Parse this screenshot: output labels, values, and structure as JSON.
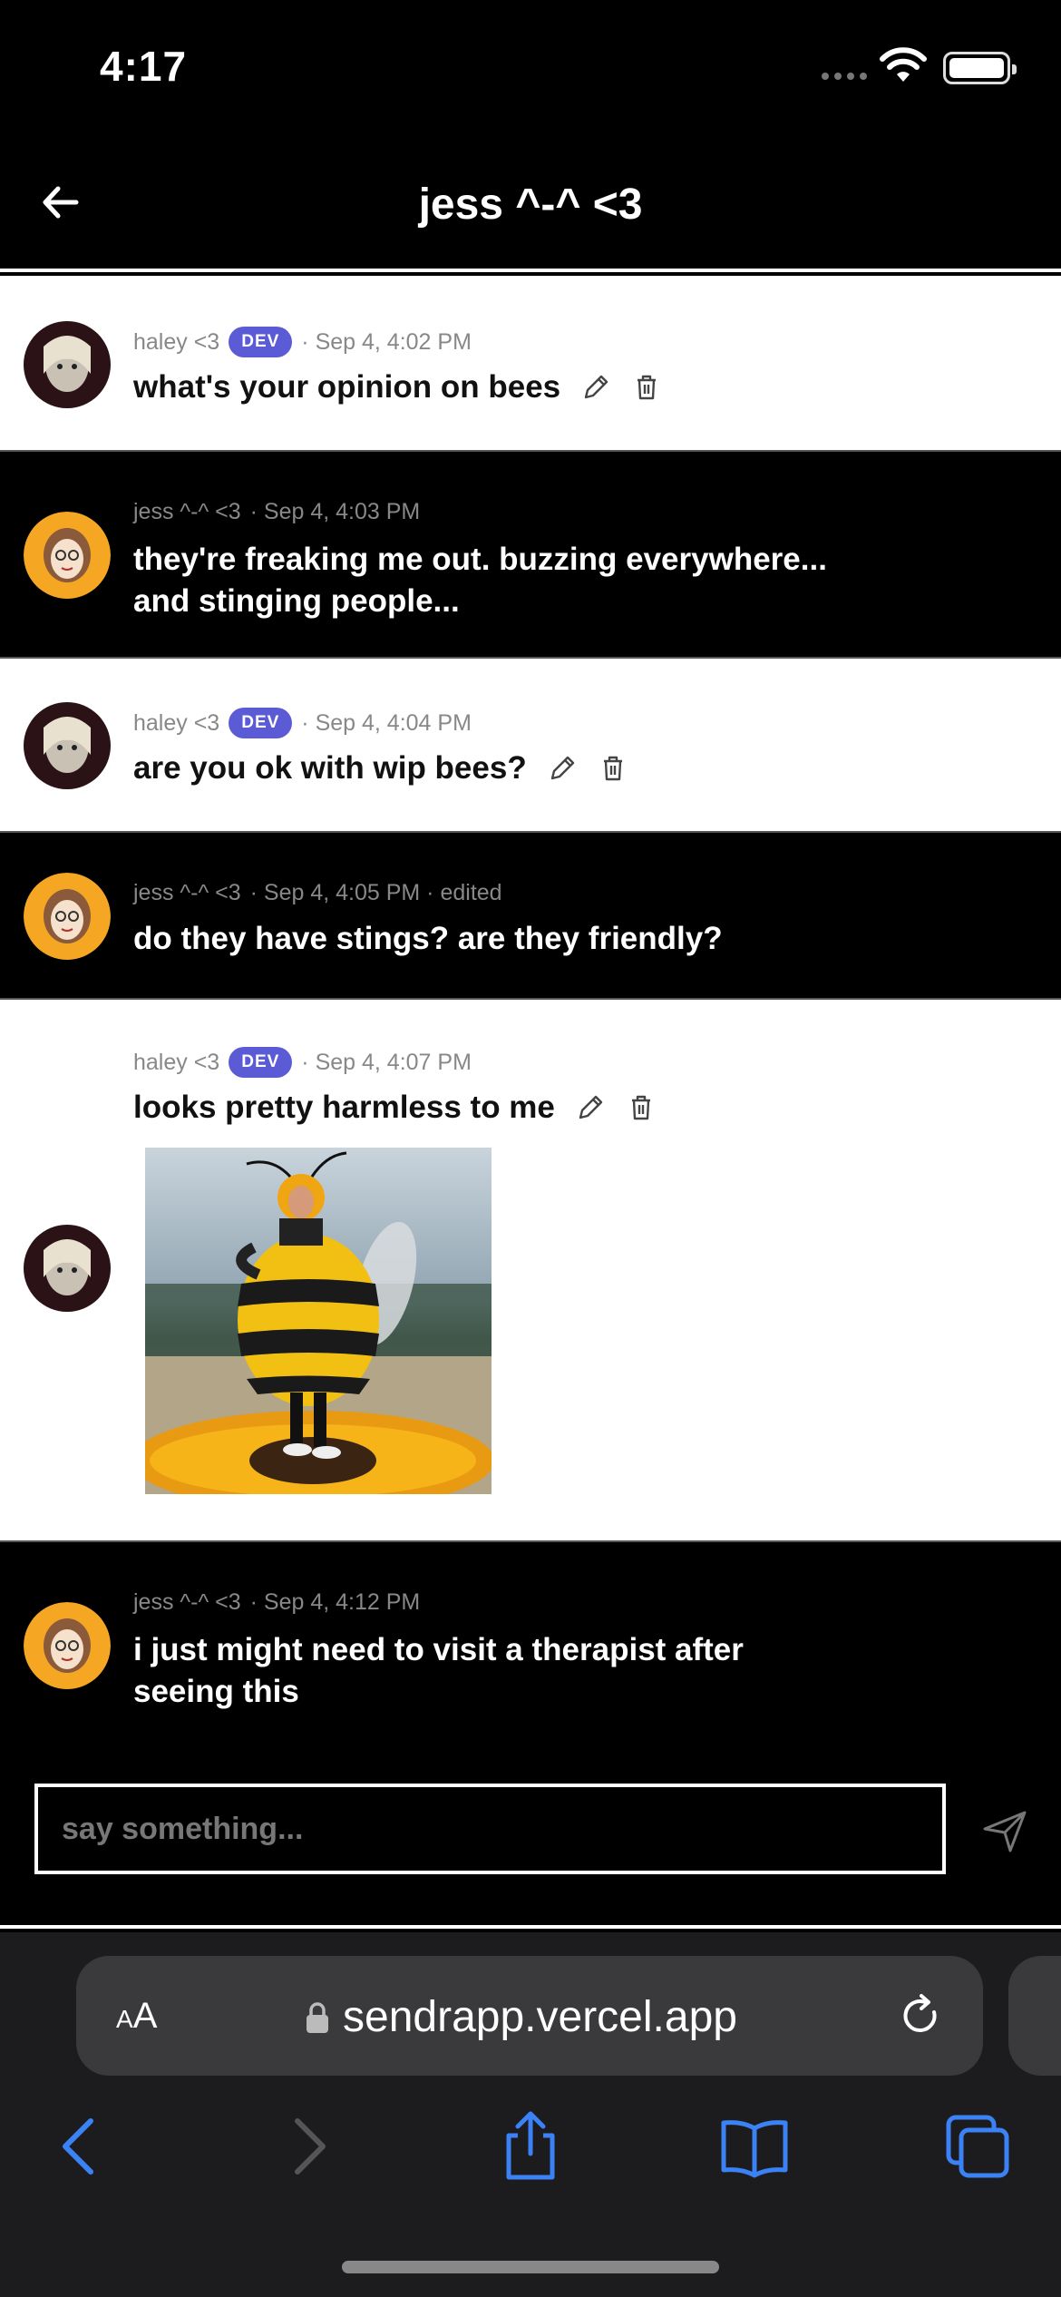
{
  "status_bar": {
    "time": "4:17"
  },
  "header": {
    "title": "jess ^-^ <3",
    "back_icon": "arrow-left-icon"
  },
  "messages": [
    {
      "author": "haley <3",
      "badge": "DEV",
      "timestamp": "· Sep 4, 4:02 PM",
      "text": "what's your opinion on bees",
      "theme": "light"
    },
    {
      "author": "jess ^-^ <3",
      "timestamp": "· Sep 4, 4:03 PM",
      "text_line1": "they're freaking me out. buzzing everywhere...",
      "text_line2": "and stinging people...",
      "theme": "dark"
    },
    {
      "author": "haley <3",
      "badge": "DEV",
      "timestamp": "· Sep 4, 4:04 PM",
      "text": "are you ok with wip bees?",
      "theme": "light"
    },
    {
      "author": "jess ^-^ <3",
      "timestamp": "· Sep 4, 4:05 PM · edited",
      "text": "do they have stings? are they friendly?",
      "theme": "dark"
    },
    {
      "author": "haley <3",
      "badge": "DEV",
      "timestamp": "· Sep 4, 4:07 PM",
      "text": "looks pretty harmless to me",
      "theme": "light",
      "has_image": true
    },
    {
      "author": "jess ^-^ <3",
      "timestamp": "· Sep 4, 4:12 PM",
      "text_line1": "i just might need to visit a therapist after",
      "text_line2": "seeing this",
      "theme": "dark"
    }
  ],
  "composer": {
    "placeholder": "say something...",
    "send_icon": "send-icon"
  },
  "browser": {
    "aa_small": "A",
    "aa_large": "A",
    "url": "sendrapp.vercel.app"
  },
  "colors": {
    "dev_badge": "#5b5bd6",
    "toolbar_blue": "#3b82f6",
    "dark_bg": "#000000",
    "light_bg": "#ffffff"
  }
}
